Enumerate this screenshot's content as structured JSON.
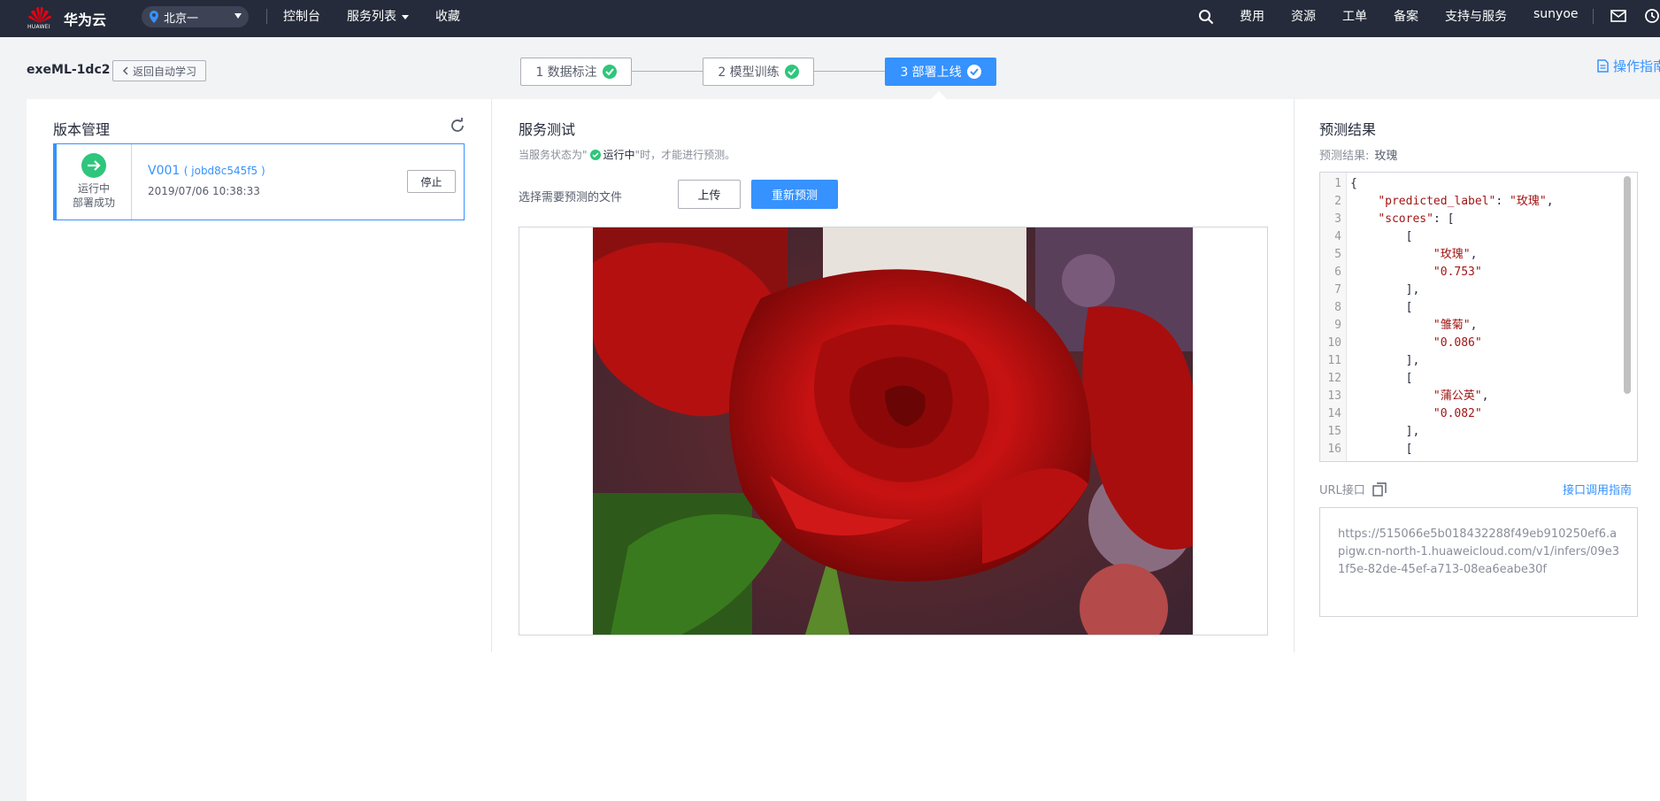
{
  "topbar": {
    "logo_text": "HUAWEI",
    "brand": "华为云",
    "region": "北京一",
    "nav": [
      "控制台",
      "服务列表",
      "收藏"
    ],
    "right_nav": [
      "费用",
      "资源",
      "工单",
      "备案",
      "支持与服务"
    ],
    "user": "sunyoe"
  },
  "subheader": {
    "job_name": "exeML-1dc2",
    "back_label": "返回自动学习",
    "steps": [
      "1 数据标注",
      "2 模型训练",
      "3 部署上线"
    ],
    "active_step": 3,
    "guide_label": "操作指南"
  },
  "version_panel": {
    "title": "版本管理",
    "card": {
      "status_line1": "运行中",
      "status_line2": "部署成功",
      "version": "V001",
      "job_id": "( jobd8c545f5 )",
      "time": "2019/07/06 10:38:33",
      "stop_label": "停止"
    }
  },
  "test_panel": {
    "title": "服务测试",
    "hint_prefix": "当服务状态为\"",
    "hint_status": "运行中",
    "hint_suffix": "\"时，才能进行预测。",
    "choose_label": "选择需要预测的文件",
    "upload_label": "上传",
    "repredict_label": "重新预测"
  },
  "result_panel": {
    "title": "预测结果",
    "summary_label": "预测结果:",
    "summary_value": "玫瑰",
    "code_lines": [
      "{",
      "    \"predicted_label\": \"玫瑰\",",
      "    \"scores\": [",
      "        [",
      "            \"玫瑰\",",
      "            \"0.753\"",
      "        ],",
      "        [",
      "            \"雏菊\",",
      "            \"0.086\"",
      "        ],",
      "        [",
      "            \"蒲公英\",",
      "            \"0.082\"",
      "        ],",
      "        ["
    ],
    "url_label": "URL接口",
    "url_guide": "接口调用指南",
    "url_value": "https://515066e5b018432288f49eb910250ef6.apigw.cn-north-1.huaweicloud.com/v1/infers/09e31f5e-82de-45ef-a713-08ea6eabe30f"
  },
  "colors": {
    "topbar": "#252b3a",
    "accent": "#3592ff",
    "success": "#2ec67c"
  }
}
